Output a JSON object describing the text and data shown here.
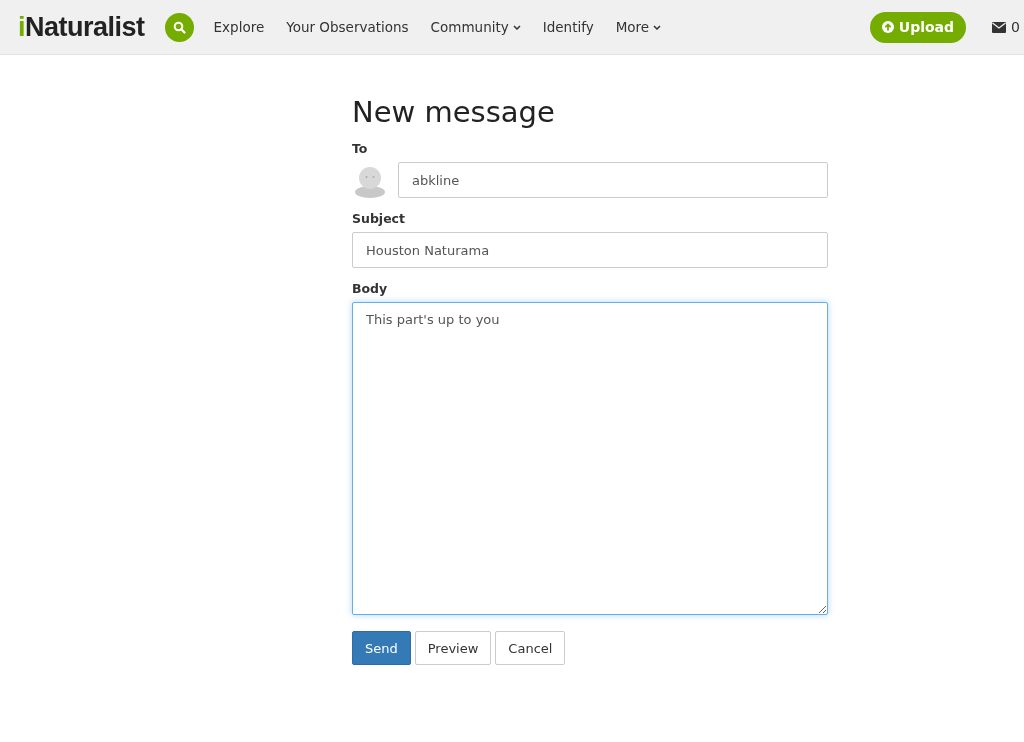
{
  "header": {
    "logo": "iNaturalist",
    "nav": [
      {
        "label": "Explore",
        "has_menu": false
      },
      {
        "label": "Your Observations",
        "has_menu": false
      },
      {
        "label": "Community",
        "has_menu": true
      },
      {
        "label": "Identify",
        "has_menu": false
      },
      {
        "label": "More",
        "has_menu": true
      }
    ],
    "upload_button": "Upload",
    "messages_count": "0"
  },
  "form": {
    "title": "New message",
    "fields": [
      {
        "kind": "recipient",
        "label": "To",
        "value": "abkline",
        "focused": false
      },
      {
        "kind": "text",
        "label": "Subject",
        "value": "Houston Naturama",
        "focused": false
      },
      {
        "kind": "textarea",
        "label": "Body",
        "value": "This part's up to you",
        "focused": true
      }
    ],
    "buttons": [
      {
        "label": "Send",
        "primary": true
      },
      {
        "label": "Preview",
        "primary": false
      },
      {
        "label": "Cancel",
        "primary": false
      }
    ]
  }
}
